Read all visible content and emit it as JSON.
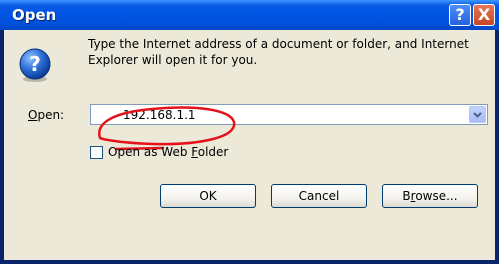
{
  "window": {
    "title": "Open"
  },
  "titlebar": {
    "help_glyph": "?",
    "close_glyph": "X",
    "help_icon": "help-icon",
    "close_icon": "close-icon"
  },
  "dialog": {
    "prompt": "Type the Internet address of a document or folder, and Internet Explorer will open it for you.",
    "icon": "question-icon",
    "open_label_mnemonic": "O",
    "open_label_rest": "pen:",
    "address_value": "192.168.1.1",
    "web_folder": {
      "pre": "Open as Web ",
      "mnemonic": "F",
      "post": "older",
      "checked": false
    }
  },
  "buttons": {
    "ok": "OK",
    "cancel": "Cancel",
    "browse_pre": "B",
    "browse_mnemonic": "r",
    "browse_post": "owse..."
  },
  "colors": {
    "titlebar_blue": "#0054e3",
    "dialog_bg": "#ece9d8",
    "annotation_red": "#e4131b"
  }
}
